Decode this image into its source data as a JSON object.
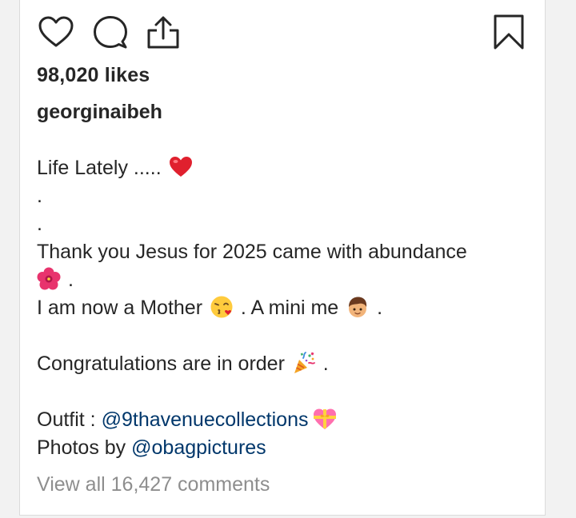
{
  "post": {
    "likes_text": "98,020 likes",
    "username": "georginaibeh",
    "caption": {
      "line1_text": "Life Lately ..... ",
      "line1_emoji": "red-heart-emoji",
      "dot1": ".",
      "dot2": ".",
      "line4_text": "Thank you Jesus for 2025 came with abundance",
      "line5_emoji": "hibiscus-emoji",
      "line5_text": " .",
      "line6_text_a": "I am now a Mother ",
      "line6_emoji_a": "face-blowing-kiss-emoji",
      "line6_text_b": " . A mini me ",
      "line6_emoji_b": "boy-emoji",
      "line6_text_c": " .",
      "line8_text": "Congratulations are in order ",
      "line8_emoji": "party-popper-emoji",
      "line8_text_end": " .",
      "outfit_label": "Outfit : ",
      "outfit_mention": "@9thavenuecollections",
      "outfit_emoji": "heart-with-ribbon-emoji",
      "photos_label": "Photos by ",
      "photos_mention": "@obagpictures"
    },
    "view_comments_text": "View all 16,427 comments"
  },
  "actions": {
    "like_icon": "heart-outline-icon",
    "comment_icon": "speech-bubble-icon",
    "share_icon": "share-upload-icon",
    "save_icon": "bookmark-outline-icon"
  },
  "colors": {
    "text": "#262626",
    "mention": "#00376b",
    "muted": "#8e8e8e",
    "border": "#dbdbdb"
  }
}
